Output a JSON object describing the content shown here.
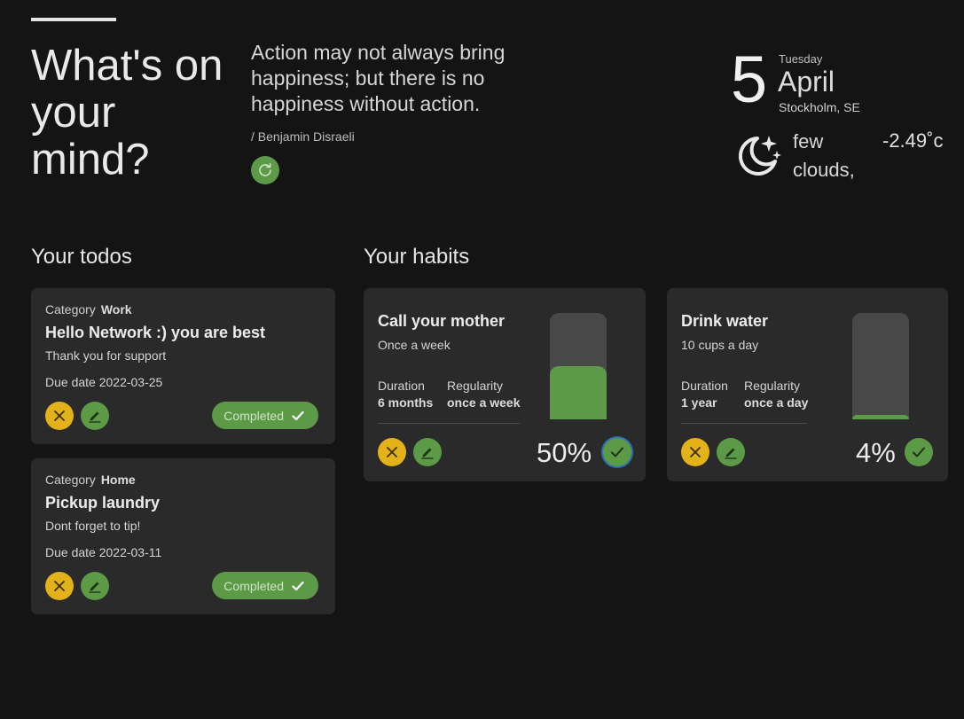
{
  "header": {
    "headline": "What's on your mind?",
    "quote": "Action may not always bring happiness; but there is no happiness without action.",
    "author": "/ Benjamin Disraeli",
    "refresh_icon": "refresh-icon"
  },
  "date": {
    "day": "5",
    "weekday": "Tuesday",
    "month": "April",
    "location": "Stockholm, SE"
  },
  "weather": {
    "icon": "moon-stars-icon",
    "description": "few clouds,",
    "temperature": "-2.49˚c"
  },
  "todos": {
    "title": "Your todos",
    "items": [
      {
        "category_label": "Category",
        "category": "Work",
        "title": "Hello Network :) you are best",
        "description": "Thank you for support",
        "due": "Due date 2022-03-25",
        "status": "Completed"
      },
      {
        "category_label": "Category",
        "category": "Home",
        "title": "Pickup laundry",
        "description": "Dont forget to tip!",
        "due": "Due date 2022-03-11",
        "status": "Completed"
      }
    ]
  },
  "habits": {
    "title": "Your habits",
    "items": [
      {
        "title": "Call your mother",
        "frequency": "Once a week",
        "duration_label": "Duration",
        "duration": "6 months",
        "regularity_label": "Regularity",
        "regularity": "once a week",
        "progress_text": "50%",
        "progress": 0.5
      },
      {
        "title": "Drink water",
        "frequency": "10 cups a day",
        "duration_label": "Duration",
        "duration": "1 year",
        "regularity_label": "Regularity",
        "regularity": "once a day",
        "progress_text": "4%",
        "progress": 0.04
      }
    ]
  },
  "colors": {
    "background": "#141414",
    "card": "#2a2a2a",
    "accent_green": "#5c9a47",
    "accent_yellow": "#e3b219",
    "bar_track": "#484848"
  }
}
